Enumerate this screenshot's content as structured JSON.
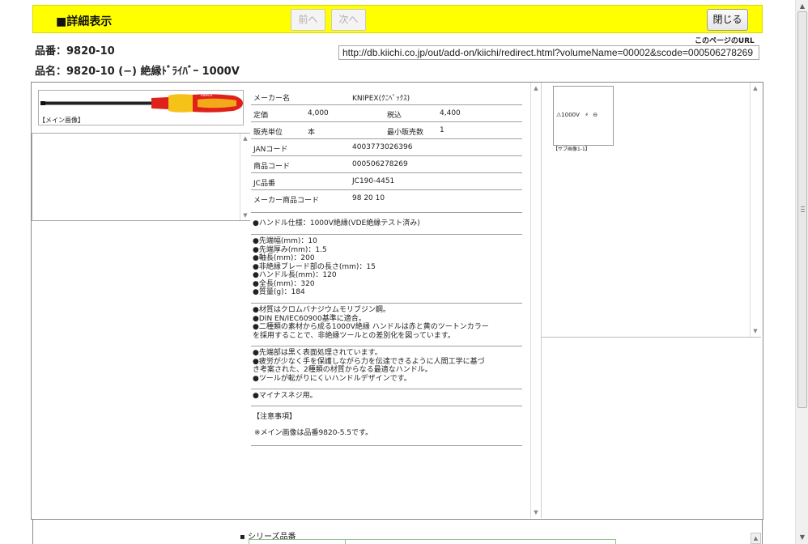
{
  "header": {
    "title": "■詳細表示",
    "prev_label": "前へ",
    "next_label": "次へ",
    "close_label": "閉じる"
  },
  "product": {
    "part_no": "品番：9820-10",
    "part_name": "品名：9820-10 (−) 絶縁ﾄﾞﾗｲﾊﾞｰ 1000V"
  },
  "page_url": {
    "label": "このページのURL",
    "value": "http://db.kiichi.co.jp/out/add-on/kiichi/redirect.html?volumeName=00002&scode=000506278269"
  },
  "main_image_caption": "【メイン画像】",
  "spec": {
    "maker_label": "メーカー名",
    "maker_value": "KNIPEX(ｸﾆﾍﾟｯｸｽ)",
    "price_label": "定価",
    "price_value": "4,000",
    "tax_label": "税込",
    "tax_value": "4,400",
    "unit_label": "販売単位",
    "unit_value": "本",
    "min_label": "最小販売数",
    "min_value": "1",
    "jan_label": "JANコード",
    "jan_value": "4003773026396",
    "code_label": "商品コード",
    "code_value": "000506278269",
    "jc_label": "JC品番",
    "jc_value": "JC190-4451",
    "maker_code_label": "メーカー商品コード",
    "maker_code_value": "98 20 10"
  },
  "descriptions": {
    "handle": [
      "●ハンドル仕様：1000V絶縁(VDE絶縁テスト済み)"
    ],
    "dims": [
      "●先端幅(mm)：10",
      "●先端厚み(mm)：1.5",
      "●軸長(mm)：200",
      "●非絶縁ブレード部の長さ(mm)：15",
      "●ハンドル長(mm)：120",
      "●全長(mm)：320",
      "●質量(g)：184"
    ],
    "material": [
      "●材質はクロムバナジウムモリブジン鋼。",
      "●DIN EN/IEC60900基準に適合。",
      "●二種類の素材から成る1000V絶縁 ハンドルは赤と黄のツートンカラー",
      "を採用することで、非絶縁ツールとの差別化を図っています。"
    ],
    "features": [
      "●先端部は黒く表面処理されています。",
      "●疲労が少なく手を保護しながら力を伝達できるように人間工学に基づ",
      "き考案された、2種類の材質からなる最適なハンドル。",
      "●ツールが転がりにくいハンドルデザインです。"
    ],
    "usage": [
      "●マイナスネジ用。"
    ]
  },
  "notes": {
    "label": "【注意事項】",
    "text": "※メイン画像は品番9820-5.5です。"
  },
  "sub_image": {
    "thumb_text": "1000V",
    "caption": "【サブ画像1-1】"
  },
  "series": {
    "label": "シリーズ品番"
  },
  "colors": {
    "header_bg": "#ffff00",
    "handle_red": "#e0211b",
    "handle_yellow": "#f6c21a",
    "shaft": "#222222"
  }
}
